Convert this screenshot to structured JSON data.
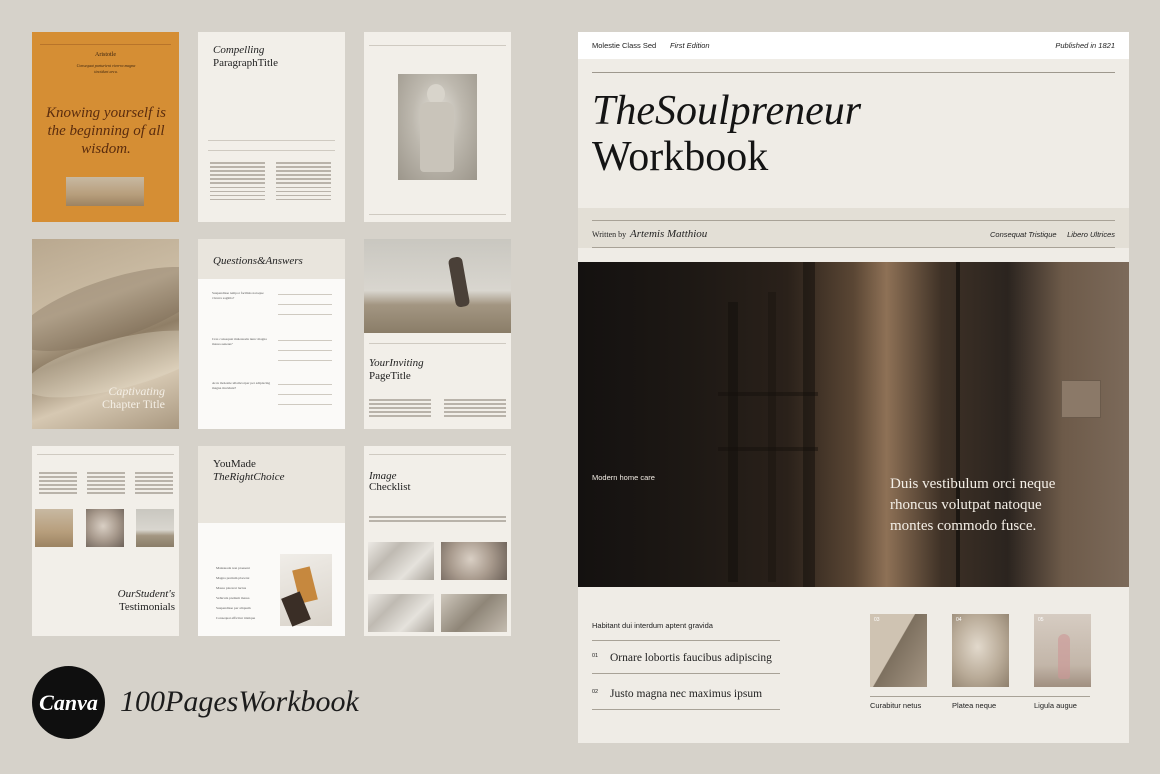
{
  "thumbs": {
    "t1": {
      "name": "Aristotle",
      "sub": "Consequat parturient viverra magna tincidunt arcu.",
      "quote": "Knowing yourself is the beginning of all wisdom."
    },
    "t2": {
      "title1": "Compelling",
      "title2": "ParagraphTitle"
    },
    "t4": {
      "title1": "Captivating",
      "title2": "Chapter Title"
    },
    "t5": {
      "title": "Questions&Answers",
      "q1": "Suspendisse tempor facilisis natoque viverra sagittis?",
      "q2": "Cras consequat malesuada nunc magna massa aenean?",
      "q3": "Arcu molestie ullamcorper per adipiscing magna tincidunt?"
    },
    "t6": {
      "title1": "YourInviting",
      "title2": "PageTitle"
    },
    "t7": {
      "title1": "OurStudent's",
      "title2": "Testimonials"
    },
    "t8": {
      "title1": "YouMade",
      "title2": "TheRightChoice",
      "items": [
        "Malesuada non praesent",
        "Magna pretium placerat",
        "Massa placerat luctus",
        "Vehicula pretium massa",
        "Suspendisse per aliquam",
        "Consequat efficitur tristique"
      ]
    },
    "t9": {
      "title1": "Image",
      "title2": "Checklist"
    }
  },
  "brand": {
    "logo_text": "Canva",
    "tagline": "100PagesWorkbook"
  },
  "big": {
    "header_left": "Molestie Class Sed",
    "header_mid": "First Edition",
    "header_right": "Published in 1821",
    "title_line1": "TheSoulpreneur",
    "title_line2": "Workbook",
    "written_by_label": "Written by",
    "author": "Artemis Matthiou",
    "byline_right1": "Consequat Tristique",
    "byline_right2": "Libero Ultrices",
    "hero_caption": "Modern home care",
    "hero_quote_line1": "Duis vestibulum orci neque",
    "hero_quote_line2": "rhoncus volutpat natoque",
    "hero_quote_line3": "montes commodo fusce.",
    "list_heading": "Habitant dui interdum aptent gravida",
    "list": [
      {
        "num": "01",
        "text": "Ornare lobortis faucibus adipiscing"
      },
      {
        "num": "02",
        "text": "Justo magna nec maximus ipsum"
      }
    ],
    "gallery": [
      {
        "num": "03",
        "caption": "Curabitur netus"
      },
      {
        "num": "04",
        "caption": "Platea neque"
      },
      {
        "num": "05",
        "caption": "Ligula augue"
      }
    ]
  },
  "colors": {
    "orange": "#d58e34",
    "background": "#d6d2ca",
    "page": "#efece6"
  }
}
